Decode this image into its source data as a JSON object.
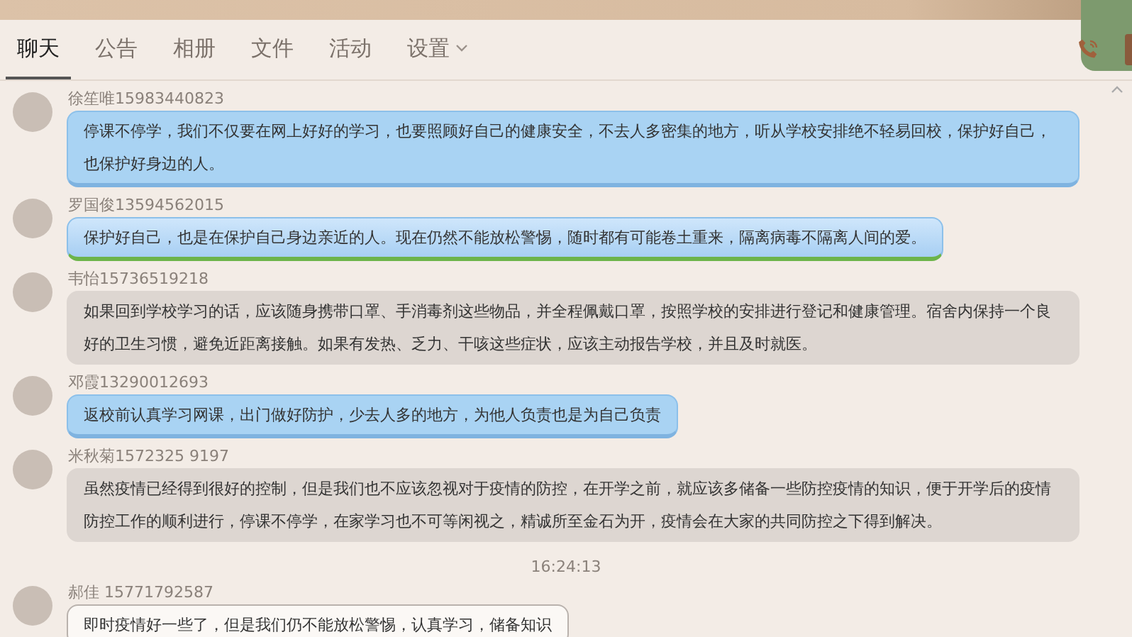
{
  "tabs": [
    {
      "label": "聊天",
      "selected": true,
      "dropdown": false
    },
    {
      "label": "公告",
      "selected": false,
      "dropdown": false
    },
    {
      "label": "相册",
      "selected": false,
      "dropdown": false
    },
    {
      "label": "文件",
      "selected": false,
      "dropdown": false
    },
    {
      "label": "活动",
      "selected": false,
      "dropdown": false
    },
    {
      "label": "设置",
      "selected": false,
      "dropdown": true
    }
  ],
  "chat": [
    {
      "kind": "blue",
      "sender": "徐笙唯15983440823",
      "text": "停课不停学，我们不仅要在网上好好的学习，也要照顾好自己的健康安全，不去人多密集的地方，听从学校安排绝不轻易回校，保护好自己，也保护好身边的人。"
    },
    {
      "kind": "blue-green",
      "sender": "罗国俊13594562015",
      "text": "保护好自己，也是在保护自己身边亲近的人。现在仍然不能放松警惕，随时都有可能卷土重来，隔离病毒不隔离人间的爱。"
    },
    {
      "kind": "grey",
      "sender": "韦怡15736519218",
      "text": "如果回到学校学习的话，应该随身携带口罩、手消毒剂这些物品，并全程佩戴口罩，按照学校的安排进行登记和健康管理。宿舍内保持一个良好的卫生习惯，避免近距离接触。如果有发热、乏力、干咳这些症状，应该主动报告学校，并且及时就医。"
    },
    {
      "kind": "blue",
      "sender": "邓霞13290012693",
      "text": "返校前认真学习网课，出门做好防护，少去人多的地方，为他人负责也是为自己负责"
    },
    {
      "kind": "grey",
      "sender": "米秋菊1572325 9197",
      "text": "虽然疫情已经得到很好的控制，但是我们也不应该忽视对于疫情的防控，在开学之前，就应该多储备一些防控疫情的知识，便于开学后的疫情防控工作的顺利进行，停课不停学，在家学习也不可等闲视之，精诚所至金石为开，疫情会在大家的共同防控之下得到解决。"
    },
    {
      "kind": "time",
      "text": "16:24:13"
    },
    {
      "kind": "white",
      "sender": "郝佳 15771792587",
      "text": "即时疫情好一些了，但是我们仍不能放松警惕，认真学习，储备知识"
    }
  ]
}
